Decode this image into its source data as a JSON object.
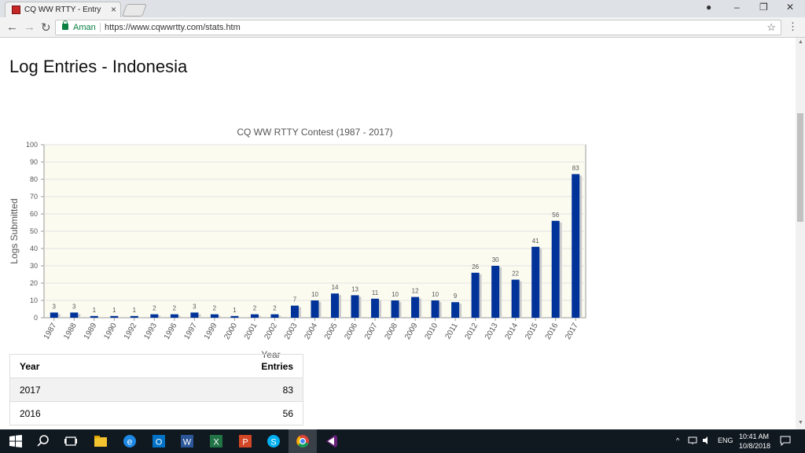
{
  "browser": {
    "tab_title": "CQ WW RTTY - Entry Stat",
    "tab_close": "×",
    "security_label": "Aman",
    "url": "https://www.cqwwrtty.com/stats.htm",
    "window_controls": {
      "profile": "●",
      "minimize": "–",
      "restore": "❐",
      "close": "✕"
    },
    "nav": {
      "back": "←",
      "forward": "→",
      "reload": "↻"
    },
    "star": "☆",
    "menu": "⋮"
  },
  "page": {
    "title": "Log Entries - Indonesia"
  },
  "chart_data": {
    "type": "bar",
    "title": "CQ WW RTTY Contest (1987 - 2017)",
    "xlabel": "Year",
    "ylabel": "Logs Submitted",
    "ylim": [
      0,
      100
    ],
    "yticks": [
      0,
      10,
      20,
      30,
      40,
      50,
      60,
      70,
      80,
      90,
      100
    ],
    "grid": true,
    "bar_color": "#003399",
    "categories": [
      "1987",
      "1988",
      "1989",
      "1990",
      "1992",
      "1993",
      "1996",
      "1997",
      "1999",
      "2000",
      "2001",
      "2002",
      "2003",
      "2004",
      "2005",
      "2006",
      "2007",
      "2008",
      "2009",
      "2010",
      "2011",
      "2012",
      "2013",
      "2014",
      "2015",
      "2016",
      "2017"
    ],
    "values": [
      3,
      3,
      1,
      1,
      1,
      2,
      2,
      3,
      2,
      1,
      2,
      2,
      7,
      10,
      14,
      13,
      11,
      10,
      12,
      10,
      9,
      26,
      30,
      22,
      41,
      56,
      83
    ]
  },
  "table": {
    "headers": {
      "year": "Year",
      "entries": "Entries"
    },
    "rows": [
      {
        "year": "2017",
        "entries": "83"
      },
      {
        "year": "2016",
        "entries": "56"
      }
    ]
  },
  "taskbar": {
    "apps": [
      "windows-start",
      "search",
      "task-view",
      "file-explorer",
      "edge",
      "outlook",
      "word",
      "excel",
      "powerpoint",
      "skype",
      "chrome",
      "visual-studio"
    ],
    "tray": {
      "chevron": "^",
      "language": "ENG"
    },
    "clock": {
      "time": "10:41 AM",
      "date": "10/8/2018"
    }
  }
}
